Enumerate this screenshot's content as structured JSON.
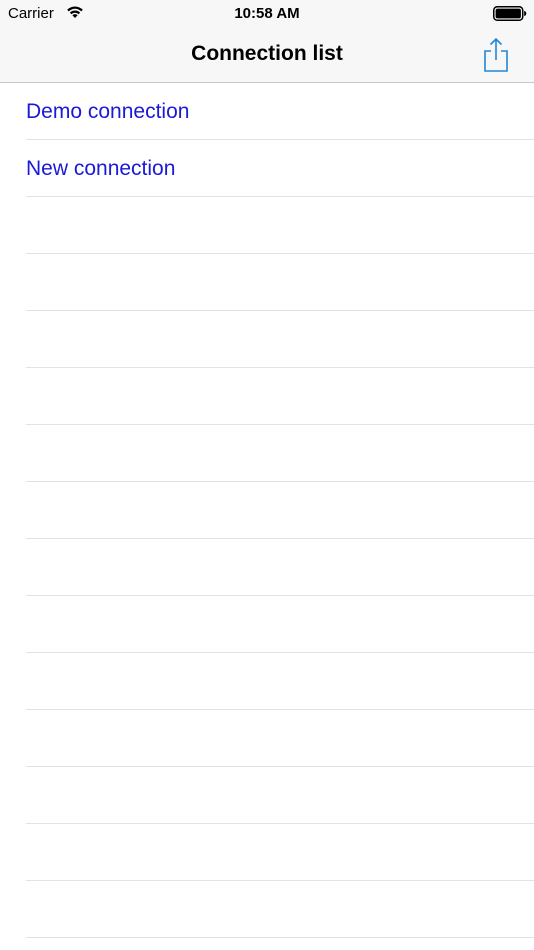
{
  "status_bar": {
    "carrier": "Carrier",
    "time": "10:58 AM"
  },
  "nav": {
    "title": "Connection list",
    "share_icon": "share-icon"
  },
  "connections": [
    {
      "label": "Demo connection"
    },
    {
      "label": "New connection"
    }
  ],
  "colors": {
    "link": "#1a1ad6",
    "tint": "#1e88d8",
    "separator": "#e3e3e6",
    "bar_background": "#f7f7f7"
  }
}
